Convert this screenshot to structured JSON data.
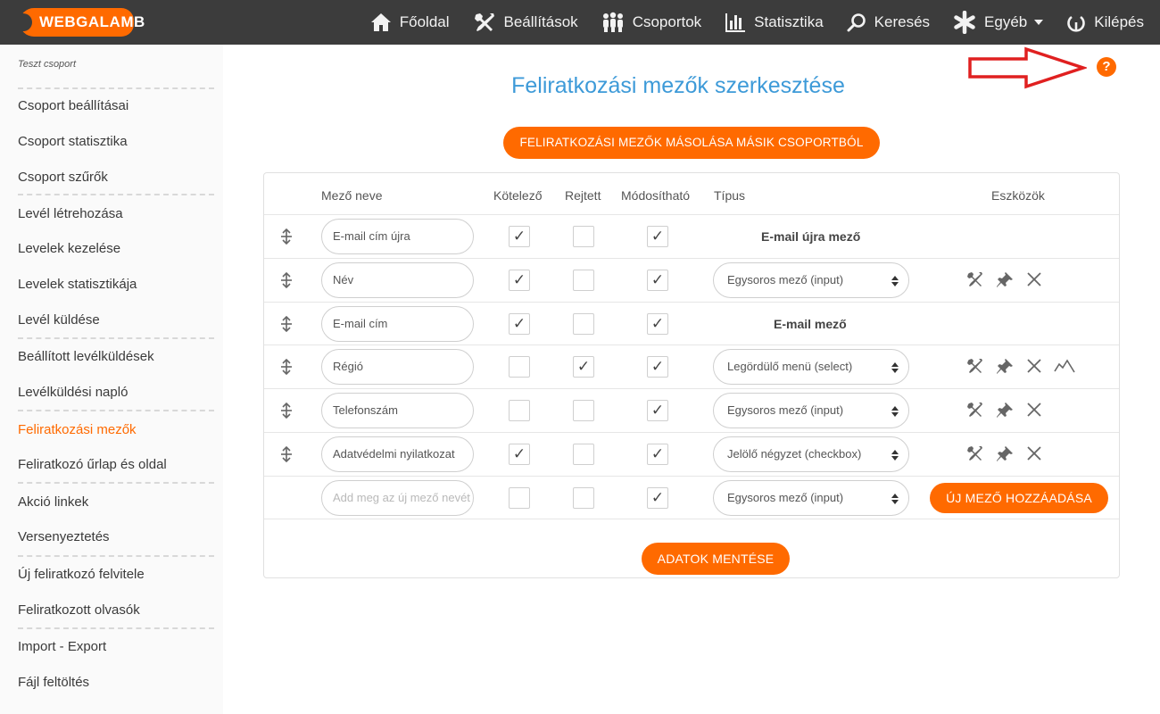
{
  "brand": {
    "logo": "WEBGALAMB",
    "accent": "#ff6a00",
    "topbar": "#3c3c3c",
    "title_color": "#3d9ad8"
  },
  "nav": [
    {
      "label": "Főoldal",
      "icon": "home-icon"
    },
    {
      "label": "Beállítások",
      "icon": "tools-icon"
    },
    {
      "label": "Csoportok",
      "icon": "people-icon"
    },
    {
      "label": "Statisztika",
      "icon": "bar-chart-icon"
    },
    {
      "label": "Keresés",
      "icon": "search-icon"
    },
    {
      "label": "Egyéb",
      "icon": "asterisk-icon"
    },
    {
      "label": "Kilépés",
      "icon": "power-icon"
    }
  ],
  "sidebar": {
    "group": "Teszt csoport",
    "items": [
      "Csoport beállításai",
      "Csoport statisztika",
      "Csoport szűrők",
      "Levél létrehozása",
      "Levelek kezelése",
      "Levelek statisztikája",
      "Levél küldése",
      "Beállított levélküldések",
      "Levélküldési napló",
      "Feliratkozási mezők",
      "Feliratkozó űrlap és oldal",
      "Akció linkek",
      "Versenyeztetés",
      "Új feliratkozó felvitele",
      "Feliratkozott olvasók",
      "Import - Export",
      "Fájl feltöltés"
    ]
  },
  "page": {
    "title": "Feliratkozási mezők szerkesztése",
    "copy_button": "FELIRATKOZÁSI MEZŐK MÁSOLÁSA MÁSIK CSOPORTBÓL",
    "help": "?",
    "save_button": "ADATOK MENTÉSE"
  },
  "table": {
    "headers": {
      "name": "Mező neve",
      "required": "Kötelező",
      "hidden": "Rejtett",
      "editable": "Módosítható",
      "type": "Típus",
      "tools": "Eszközök"
    },
    "rows": [
      {
        "name": "E-mail cím újra",
        "required": "✓",
        "hidden": "",
        "editable": "✓",
        "type_label": "E-mail újra mező"
      },
      {
        "name": "Név",
        "required": "✓",
        "hidden": "",
        "editable": "✓",
        "type_select": "Egysoros mező (input)"
      },
      {
        "name": "E-mail cím",
        "required": "✓",
        "hidden": "",
        "editable": "✓",
        "type_label": "E-mail mező"
      },
      {
        "name": "Régió",
        "required": "",
        "hidden": "✓",
        "editable": "✓",
        "type_select": "Legördülő menü (select)"
      },
      {
        "name": "Telefonszám",
        "required": "",
        "hidden": "",
        "editable": "✓",
        "type_select": "Egysoros mező (input)"
      },
      {
        "name": "Adatvédelmi nyilatkozat",
        "required": "✓",
        "hidden": "",
        "editable": "✓",
        "type_select": "Jelölő négyzet (checkbox)"
      }
    ],
    "new_row": {
      "placeholder": "Add meg az új mező nevét",
      "required": "",
      "hidden": "",
      "editable": "✓",
      "type_select": "Egysoros mező (input)",
      "add_button": "ÚJ MEZŐ HOZZÁADÁSA"
    }
  }
}
